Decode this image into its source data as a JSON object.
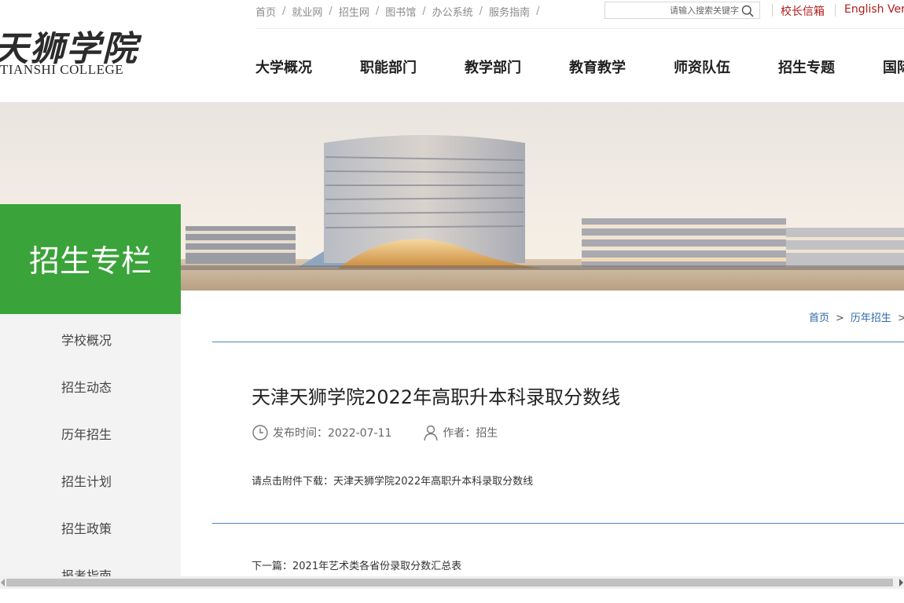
{
  "logo": {
    "cn": "天狮学院",
    "en": "TIANSHI COLLEGE"
  },
  "top_links": [
    "首页",
    "就业网",
    "招生网",
    "图书馆",
    "办公系统",
    "服务指南"
  ],
  "top_sep": "/",
  "search": {
    "placeholder": "请输入搜索关键字"
  },
  "mailbox_label": "校长信箱",
  "english_label": "English Ver",
  "nav": [
    "大学概况",
    "职能部门",
    "教学部门",
    "教育教学",
    "师资队伍",
    "招生专题",
    "国际"
  ],
  "sidebar": {
    "title": "招生专栏",
    "items": [
      "学校概况",
      "招生动态",
      "历年招生",
      "招生计划",
      "招生政策",
      "报考指南"
    ]
  },
  "breadcrumb": {
    "items": [
      "首页",
      "历年招生"
    ],
    "sep": ">"
  },
  "article": {
    "title": "天津天狮学院2022年高职升本科录取分数线",
    "publish_label": "发布时间：2022-07-11",
    "author_label": "作者：招生",
    "attachment": "请点击附件下载：天津天狮学院2022年高职升本科录取分数线",
    "next": "下一篇：2021年艺术类各省份录取分数汇总表"
  },
  "colors": {
    "green": "#3aa33a",
    "red": "#b31b1b",
    "link_blue": "#2d6aa8",
    "rule_blue": "#5583c2"
  },
  "icons": [
    "search-icon",
    "clock-icon",
    "user-icon"
  ]
}
